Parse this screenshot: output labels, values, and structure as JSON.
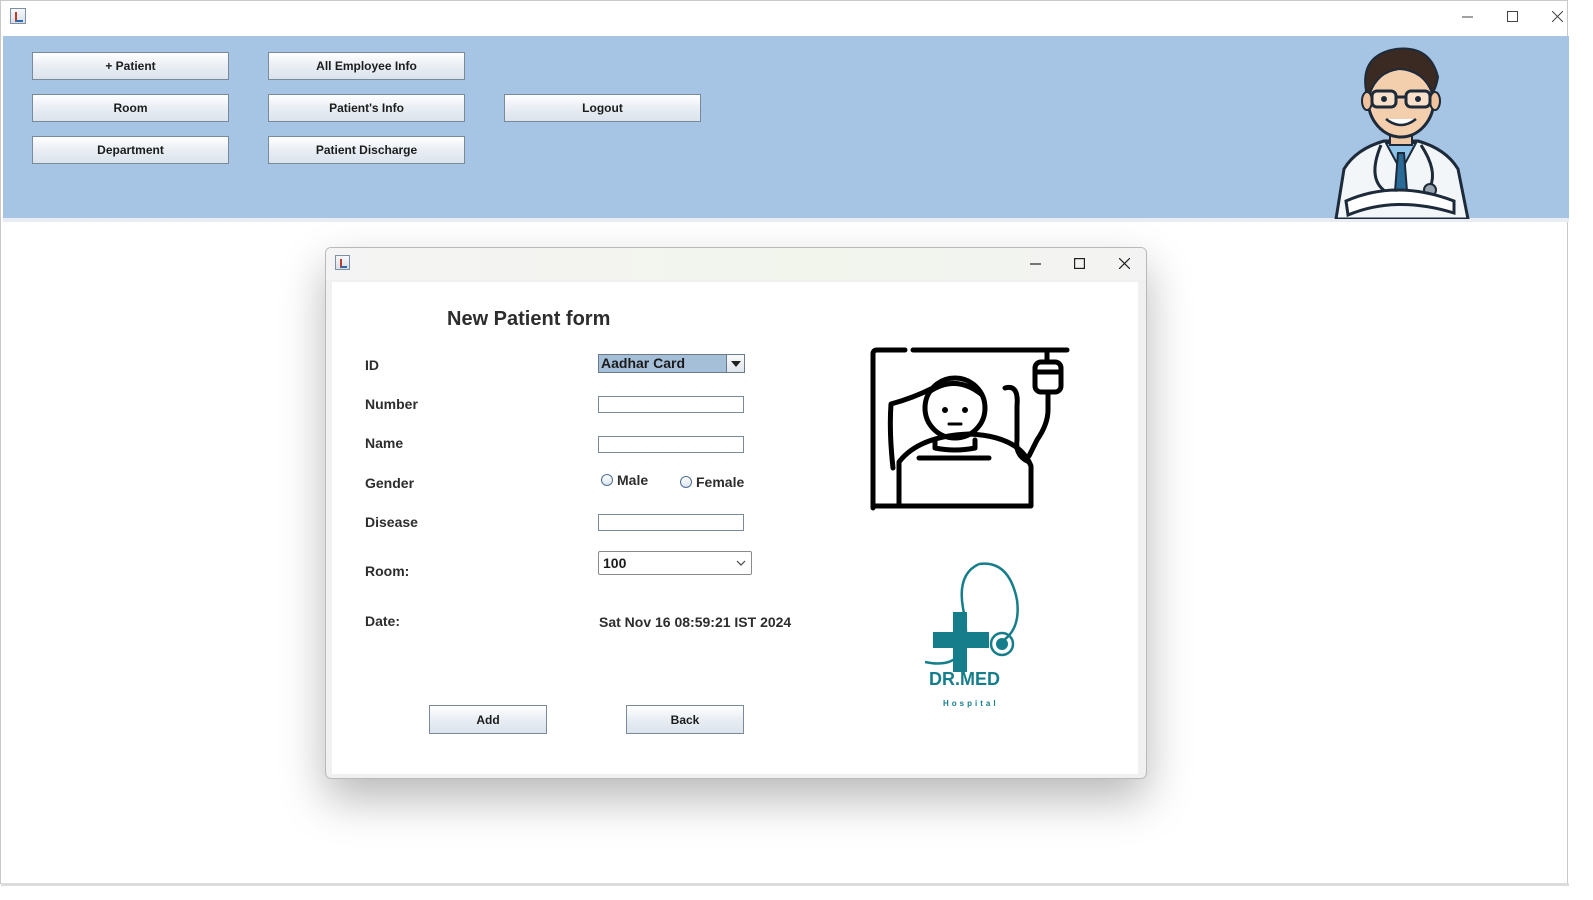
{
  "main": {
    "buttons": {
      "add_patient": "+ Patient",
      "room": "Room",
      "department": "Department",
      "all_employee_info": "All Employee Info",
      "patients_info": "Patient's Info",
      "patient_discharge": "Patient Discharge",
      "logout": "Logout"
    },
    "banner_color": "#a6c4e4"
  },
  "dialog": {
    "title": "New Patient form",
    "labels": {
      "id": "ID",
      "number": "Number",
      "name": "Name",
      "gender": "Gender",
      "disease": "Disease",
      "room": "Room:",
      "date": "Date:"
    },
    "id_type_selected": "Aadhar Card",
    "number_value": "",
    "name_value": "",
    "disease_value": "",
    "gender_options": {
      "male": "Male",
      "female": "Female"
    },
    "room_selected": "100",
    "date_value": "Sat Nov 16 08:59:21 IST 2024",
    "buttons": {
      "add": "Add",
      "back": "Back"
    },
    "logo": {
      "name": "DR.MED",
      "subtitle": "Hospital",
      "color": "#167e8a"
    }
  }
}
